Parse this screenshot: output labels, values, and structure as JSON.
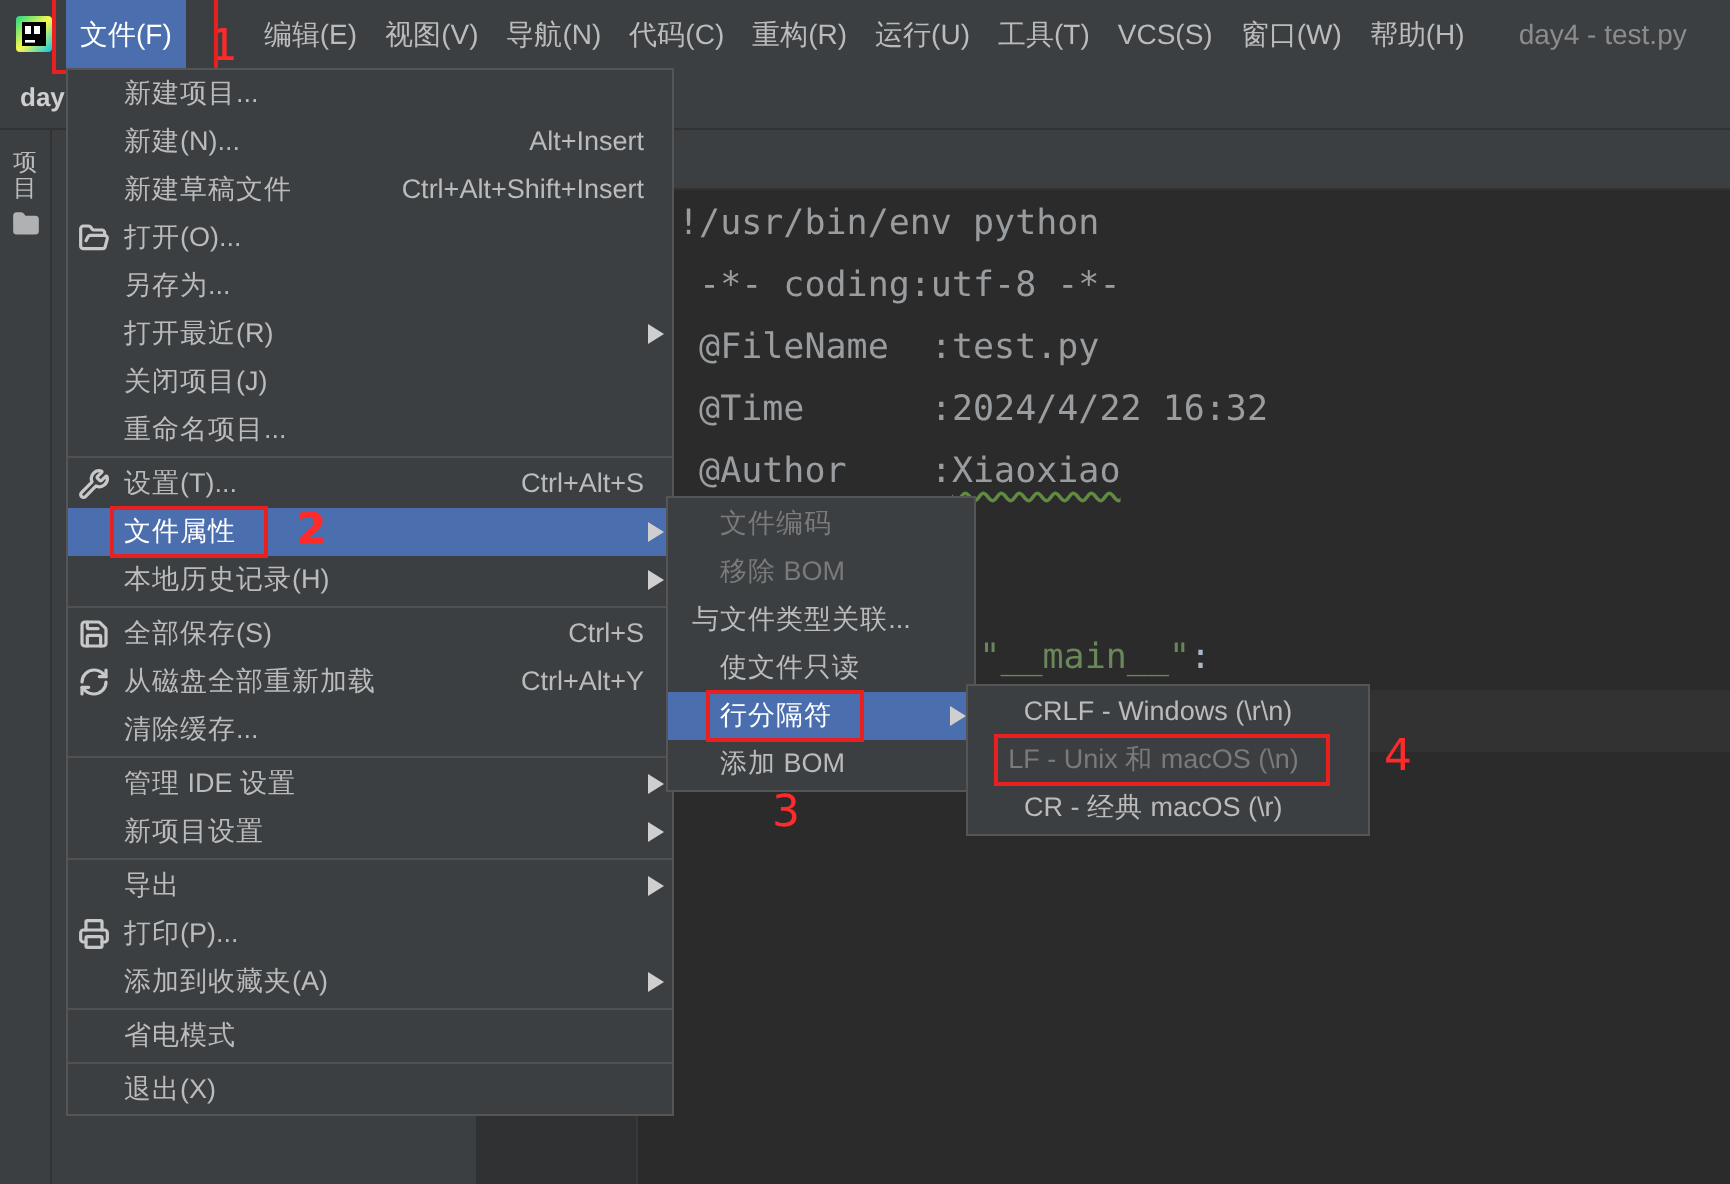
{
  "menubar": {
    "items": [
      {
        "label": "文件(F)",
        "selected": true,
        "annotation": {
          "number": "1"
        }
      },
      {
        "label": "编辑(E)",
        "selected": false
      },
      {
        "label": "视图(V)",
        "selected": false
      },
      {
        "label": "导航(N)",
        "selected": false
      },
      {
        "label": "代码(C)",
        "selected": false
      },
      {
        "label": "重构(R)",
        "selected": false
      },
      {
        "label": "运行(U)",
        "selected": false
      },
      {
        "label": "工具(T)",
        "selected": false
      },
      {
        "label": "VCS(S)",
        "selected": false
      },
      {
        "label": "窗口(W)",
        "selected": false
      },
      {
        "label": "帮助(H)",
        "selected": false
      }
    ],
    "title": "day4 - test.py"
  },
  "breadcrumb": "day",
  "tool_strip": {
    "label": "项目"
  },
  "code": {
    "lines": [
      {
        "kind": "full",
        "segments": [
          {
            "text": "!/usr/bin/env python",
            "kind": "comment"
          }
        ]
      },
      {
        "kind": "full",
        "segments": [
          {
            "text": " -*- coding:utf-8 -*-",
            "kind": "comment"
          }
        ]
      },
      {
        "kind": "full",
        "segments": [
          {
            "text": " @FileName  :test.py",
            "kind": "comment"
          }
        ]
      },
      {
        "kind": "full",
        "segments": [
          {
            "text": " @Time      :2024/4/22 16:32",
            "kind": "comment"
          }
        ]
      },
      {
        "kind": "full",
        "segments": [
          {
            "text": " @Author    :",
            "kind": "comment"
          },
          {
            "text": "Xiaoxiao",
            "kind": "typo"
          }
        ]
      },
      {
        "kind": "partial",
        "segments": [
          {
            "text": "\"__main__\"",
            "kind": "string"
          },
          {
            "text": ":",
            "kind": "plain"
          }
        ]
      }
    ]
  },
  "file_menu": {
    "groups": [
      [
        {
          "label": "新建项目...",
          "submenu": false,
          "selected": false,
          "disabled": false
        },
        {
          "label": "新建(N)...",
          "shortcut": "Alt+Insert",
          "submenu": false,
          "selected": false,
          "disabled": false
        },
        {
          "label": "新建草稿文件",
          "shortcut": "Ctrl+Alt+Shift+Insert",
          "submenu": false,
          "selected": false,
          "disabled": false
        },
        {
          "label": "打开(O)...",
          "submenu": false,
          "selected": false,
          "disabled": false
        },
        {
          "label": "另存为...",
          "submenu": false,
          "selected": false,
          "disabled": false
        },
        {
          "label": "打开最近(R)",
          "submenu": true,
          "selected": false,
          "disabled": false
        },
        {
          "label": "关闭项目(J)",
          "submenu": false,
          "selected": false,
          "disabled": false
        },
        {
          "label": "重命名项目...",
          "submenu": false,
          "selected": false,
          "disabled": false
        }
      ],
      [
        {
          "label": "设置(T)...",
          "shortcut": "Ctrl+Alt+S",
          "submenu": false,
          "selected": false,
          "disabled": false
        },
        {
          "label": "文件属性",
          "submenu": true,
          "selected": true,
          "disabled": false,
          "annotation": {
            "number": "2"
          }
        },
        {
          "label": "本地历史记录(H)",
          "submenu": true,
          "selected": false,
          "disabled": false
        }
      ],
      [
        {
          "label": "全部保存(S)",
          "shortcut": "Ctrl+S",
          "submenu": false,
          "selected": false,
          "disabled": false
        },
        {
          "label": "从磁盘全部重新加载",
          "shortcut": "Ctrl+Alt+Y",
          "submenu": false,
          "selected": false,
          "disabled": false
        },
        {
          "label": "清除缓存...",
          "submenu": false,
          "selected": false,
          "disabled": false
        }
      ],
      [
        {
          "label": "管理 IDE 设置",
          "submenu": true,
          "selected": false,
          "disabled": false
        },
        {
          "label": "新项目设置",
          "submenu": true,
          "selected": false,
          "disabled": false
        }
      ],
      [
        {
          "label": "导出",
          "submenu": true,
          "selected": false,
          "disabled": false
        },
        {
          "label": "打印(P)...",
          "submenu": false,
          "selected": false,
          "disabled": false
        },
        {
          "label": "添加到收藏夹(A)",
          "submenu": true,
          "selected": false,
          "disabled": false
        }
      ],
      [
        {
          "label": "省电模式",
          "submenu": false,
          "selected": false,
          "disabled": false
        }
      ],
      [
        {
          "label": "退出(X)",
          "submenu": false,
          "selected": false,
          "disabled": false
        }
      ]
    ]
  },
  "file_properties_menu": {
    "items": [
      {
        "label": "文件编码",
        "submenu": false,
        "selected": false,
        "disabled": true
      },
      {
        "label": "移除 BOM",
        "submenu": false,
        "selected": false,
        "disabled": true
      },
      {
        "label": "与文件类型关联...",
        "submenu": false,
        "selected": false,
        "disabled": false
      },
      {
        "label": "使文件只读",
        "submenu": false,
        "selected": false,
        "disabled": false
      },
      {
        "label": "行分隔符",
        "submenu": true,
        "selected": true,
        "disabled": false,
        "annotation": {
          "number": "3"
        }
      },
      {
        "label": "添加 BOM",
        "submenu": false,
        "selected": false,
        "disabled": false
      }
    ]
  },
  "line_separator_menu": {
    "items": [
      {
        "label": "CRLF - Windows (\\r\\n)",
        "submenu": false,
        "selected": false,
        "disabled": false
      },
      {
        "label": "LF - Unix 和 macOS (\\n)",
        "submenu": false,
        "selected": false,
        "disabled": true,
        "annotation": {
          "number": "4"
        }
      },
      {
        "label": "CR - 经典 macOS (\\r)",
        "submenu": false,
        "selected": false,
        "disabled": false
      }
    ]
  }
}
